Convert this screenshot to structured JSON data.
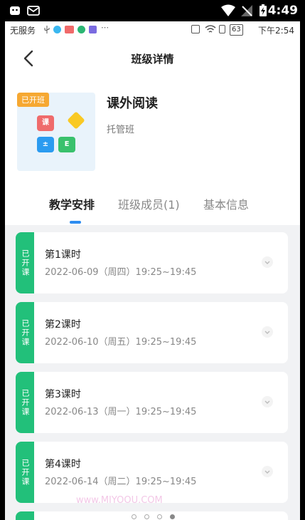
{
  "system_bar": {
    "time": "4:49"
  },
  "status_bar": {
    "carrier": "无服务",
    "battery": "63",
    "time": "下午2:54"
  },
  "header": {
    "title": "班级详情"
  },
  "course": {
    "tag": "已开班",
    "name": "课外阅读",
    "type": "托管班",
    "icon_letters": [
      "课",
      "±",
      "E"
    ]
  },
  "tabs": [
    {
      "label": "教学安排",
      "active": true
    },
    {
      "label": "班级成员(1)",
      "active": false
    },
    {
      "label": "基本信息",
      "active": false
    }
  ],
  "lessons": [
    {
      "badge": "已开课",
      "title": "第1课时",
      "time": "2022-06-09（周四）19:25~19:45"
    },
    {
      "badge": "已开课",
      "title": "第2课时",
      "time": "2022-06-10（周五）19:25~19:45"
    },
    {
      "badge": "已开课",
      "title": "第3课时",
      "time": "2022-06-13（周一）19:25~19:45"
    },
    {
      "badge": "已开课",
      "title": "第4课时",
      "time": "2022-06-14（周二）19:25~19:45"
    }
  ],
  "watermark": "www.MIYOOU.COM",
  "colors": {
    "accent_blue": "#2d8cf0",
    "badge_green": "#22c07a",
    "tag_orange": "#f6a832"
  }
}
